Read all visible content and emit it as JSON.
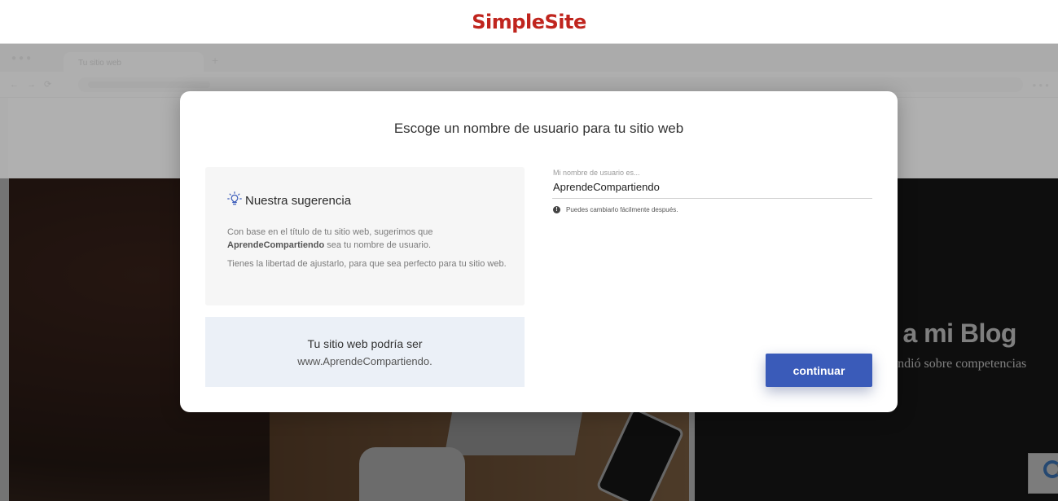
{
  "header": {
    "logo": "SimpleSite"
  },
  "background": {
    "browser_tab": "Tu sitio web",
    "hero_title": "o a mi Blog",
    "hero_subtitle": "endió sobre competencias"
  },
  "modal": {
    "title": "Escoge un nombre de usuario para tu sitio web",
    "suggestion": {
      "heading": "Nuestra sugerencia",
      "p1_before": "Con base en el título de tu sitio web, sugerimos que ",
      "p1_bold": "AprendeCompartiendo",
      "p1_after": " sea tu nombre de usuario.",
      "p2": "Tienes la libertad de ajustarlo, para que sea perfecto para tu sitio web."
    },
    "preview": {
      "line1": "Tu sitio web podría ser",
      "line2": "www.AprendeCompartiendo."
    },
    "username_field": {
      "label": "Mi nombre de usuario es...",
      "value": "AprendeCompartiendo",
      "hint": "Puedes cambiarlo fácilmente después."
    },
    "continue_label": "continuar"
  },
  "colors": {
    "brand": "#c0251e",
    "primary_button": "#3a5bb9",
    "preview_bg": "#ebf0f7"
  },
  "icons": {
    "suggestion": "lightbulb-icon",
    "hint": "info-icon"
  }
}
